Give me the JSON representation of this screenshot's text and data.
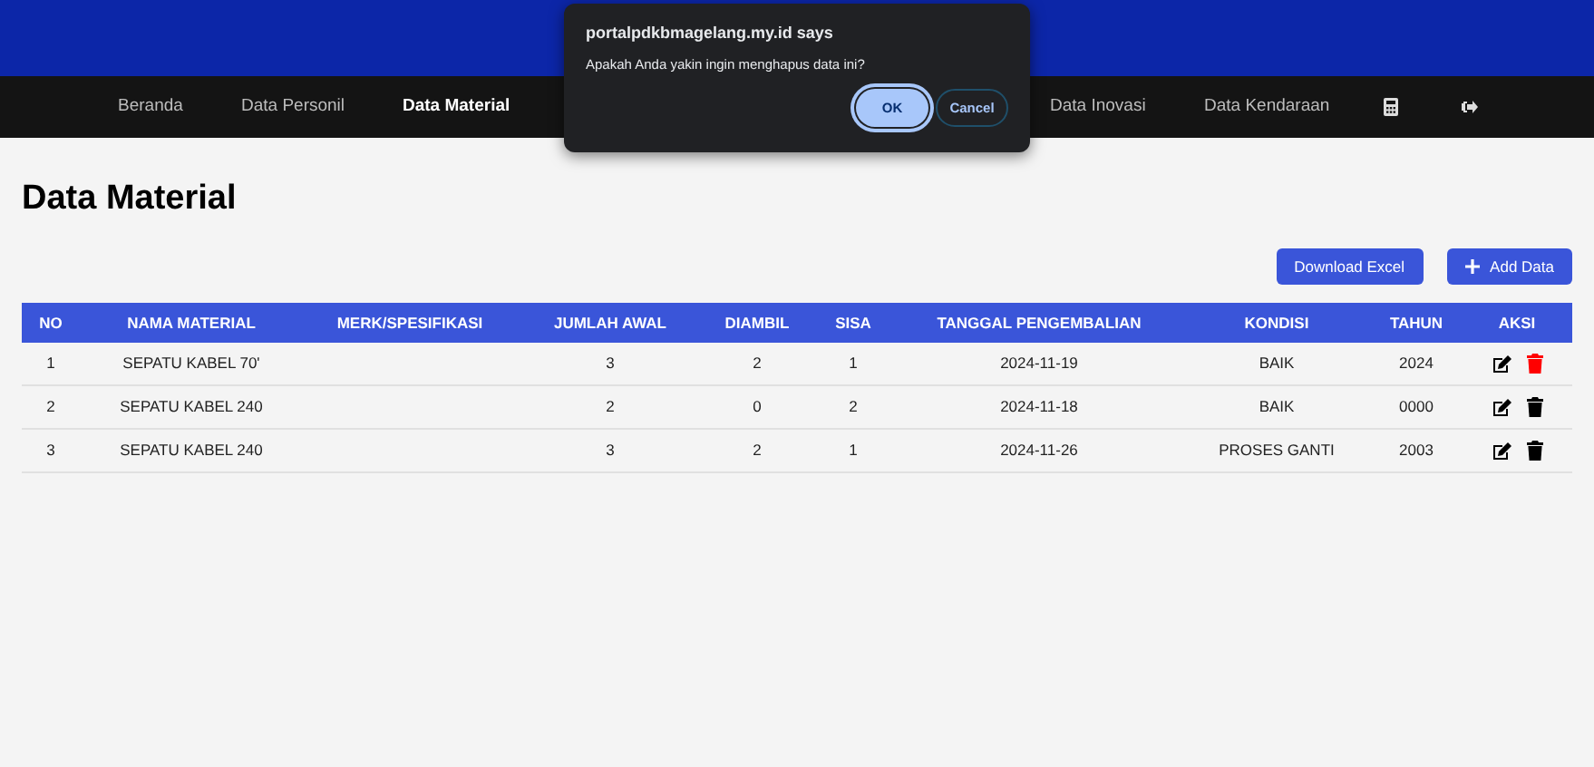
{
  "nav": {
    "items": [
      {
        "label": "Beranda",
        "selected": false
      },
      {
        "label": "Data Personil",
        "selected": false
      },
      {
        "label": "Data Material",
        "selected": true
      },
      {
        "label": "Data Inovasi",
        "selected": false
      },
      {
        "label": "Data Kendaraan",
        "selected": false
      }
    ]
  },
  "page_title": "Data Material",
  "buttons": [
    {
      "kind": "plain",
      "label": "Download Excel"
    },
    {
      "kind": "add",
      "label": "Add Data"
    }
  ],
  "table": {
    "columns": [
      "NO",
      "NAMA MATERIAL",
      "MERK/SPESIFIKASI",
      "JUMLAH AWAL",
      "DIAMBIL",
      "SISA",
      "TANGGAL PENGEMBALIAN",
      "KONDISI",
      "TAHUN",
      "AKSI"
    ],
    "rows": [
      {
        "cells": [
          "1",
          "SEPATU KABEL 70'",
          "",
          "3",
          "2",
          "1",
          "2024-11-19",
          "BAIK",
          "2024"
        ],
        "delete_hovered": true
      },
      {
        "cells": [
          "2",
          "SEPATU KABEL 240",
          "",
          "2",
          "0",
          "2",
          "2024-11-18",
          "BAIK",
          "0000"
        ],
        "delete_hovered": false
      },
      {
        "cells": [
          "3",
          "SEPATU KABEL 240",
          "",
          "3",
          "2",
          "1",
          "2024-11-26",
          "PROSES GANTI",
          "2003"
        ],
        "delete_hovered": false
      }
    ]
  },
  "dialog": {
    "title": "portalpdkbmagelang.my.id says",
    "message": "Apakah Anda yakin ingin menghapus data ini?",
    "buttons": [
      {
        "label": "OK",
        "selected": true
      },
      {
        "label": "Cancel",
        "selected": false
      }
    ]
  }
}
